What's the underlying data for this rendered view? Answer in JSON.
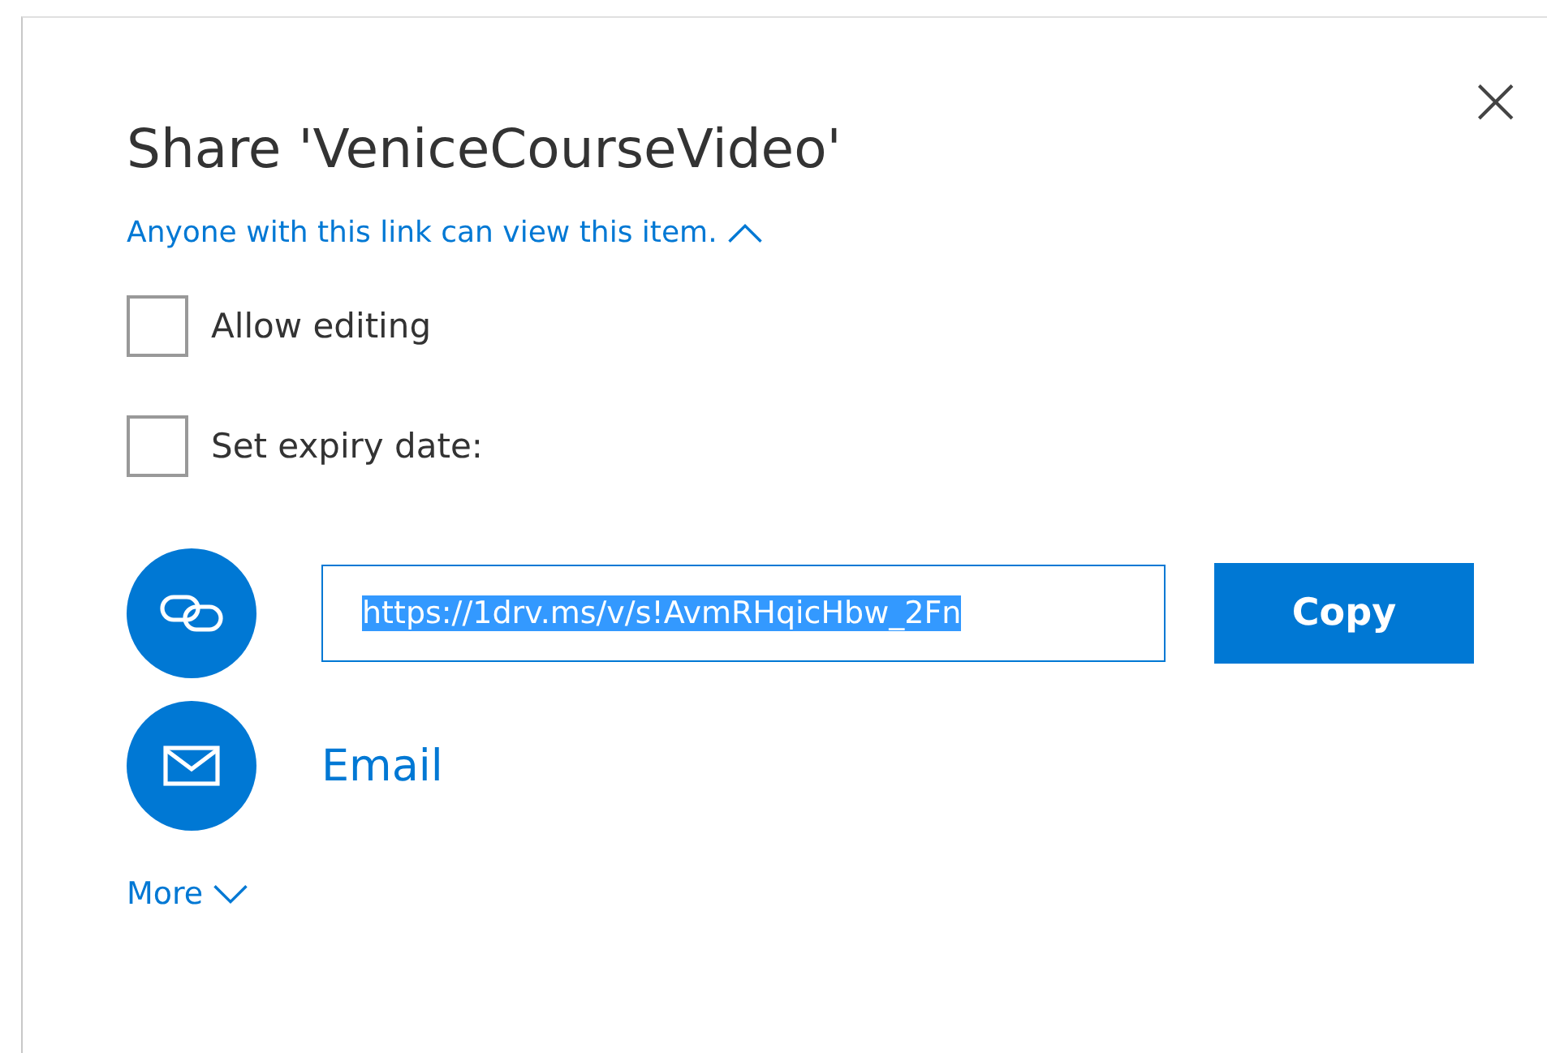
{
  "dialog": {
    "title": "Share 'VeniceCourseVideo'",
    "close": "×"
  },
  "permission_link": {
    "label": "Anyone with this link can view this item.",
    "expanded": true
  },
  "options": [
    {
      "label": "Allow editing",
      "checked": false
    },
    {
      "label": "Set expiry date:",
      "checked": false
    }
  ],
  "link": {
    "value": "https://1drv.ms/v/s!AvmRHqicHbw_2Fn",
    "text_selected": true
  },
  "copy_button": "Copy",
  "email": {
    "label": "Email"
  },
  "more": {
    "label": "More",
    "expanded": false
  }
}
